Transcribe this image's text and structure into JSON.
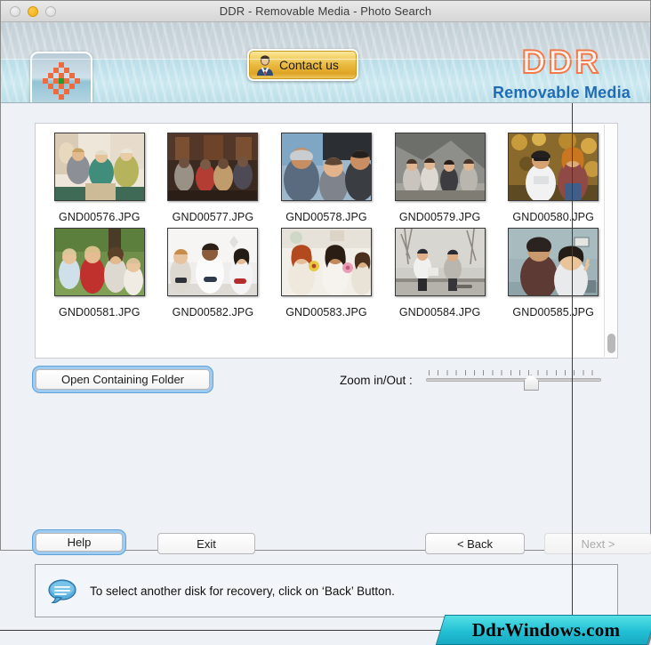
{
  "window": {
    "title": "DDR - Removable Media - Photo Search",
    "traffic_lights": [
      "close",
      "minimize",
      "zoom"
    ]
  },
  "header": {
    "app_icon_name": "checkered-flower-logo",
    "contact_button": "Contact us",
    "brand_title": "DDR",
    "brand_subtitle": "Removable Media",
    "brand_color": "#f07a4a",
    "brand_sub_color": "#1f6db5"
  },
  "thumbnails": [
    {
      "filename": "GND00576.JPG",
      "alt": "three women sitting on a sofa talking"
    },
    {
      "filename": "GND00577.JPG",
      "alt": "group of older men sitting on chairs outdoors"
    },
    {
      "filename": "GND00578.JPG",
      "alt": "young people in beanies smiling outdoors"
    },
    {
      "filename": "GND00579.JPG",
      "alt": "four young women sitting on rocks"
    },
    {
      "filename": "GND00580.JPG",
      "alt": "two women in autumn leaves airplane mode shirt"
    },
    {
      "filename": "GND00581.JPG",
      "alt": "family with children outdoors in a garden"
    },
    {
      "filename": "GND00582.JPG",
      "alt": "three friends playing video games indoors"
    },
    {
      "filename": "GND00583.JPG",
      "alt": "women holding flowers in a bright room"
    },
    {
      "filename": "GND00584.JPG",
      "alt": "two men sitting on a bench with skateboard"
    },
    {
      "filename": "GND00585.JPG",
      "alt": "grandmother and child smiling indoors"
    }
  ],
  "controls": {
    "open_folder_button": "Open Containing Folder",
    "zoom_label": "Zoom in/Out :",
    "zoom_value": 56,
    "zoom_min": 0,
    "zoom_max": 100,
    "zoom_tick_count": 20
  },
  "buttons": {
    "help": "Help",
    "exit": "Exit",
    "back": "< Back",
    "next": "Next >",
    "next_disabled": true
  },
  "status": {
    "icon_name": "speech-bubble-icon",
    "message": "To select another disk for recovery, click on ‘Back’ Button."
  },
  "watermark": {
    "text": "DdrWindows.com",
    "color": "#22c0d4"
  }
}
